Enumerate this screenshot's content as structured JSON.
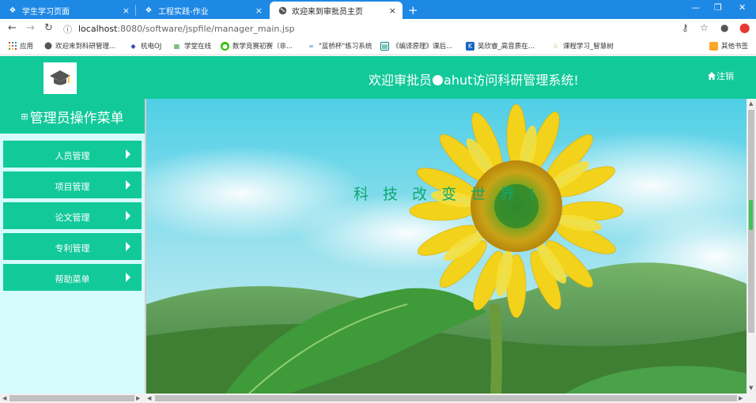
{
  "browser": {
    "tabs": [
      {
        "title": "学生学习页面",
        "close": "×"
      },
      {
        "title": "工程实践-作业",
        "close": "×"
      },
      {
        "title": "欢迎来到审批员主页",
        "close": "×"
      }
    ],
    "new_tab": "+",
    "url_host": "localhost",
    "url_path": ":8080/software/jspfile/manager_main.jsp"
  },
  "bookmarks": [
    {
      "label": "应用",
      "icon": "apps-grid-icon",
      "color": "#e53935"
    },
    {
      "label": "欢迎来到科研管理...",
      "icon": "globe-icon",
      "color": "#555555"
    },
    {
      "label": "杭电OJ",
      "icon": "site-icon",
      "color": "#3949ab"
    },
    {
      "label": "学堂在线",
      "icon": "school-icon",
      "color": "#43a047"
    },
    {
      "label": "数学竞赛初赛（非...",
      "icon": "wechat-icon",
      "color": "#2ec100"
    },
    {
      "label": "\"蓝桥杯\"练习系统",
      "icon": "lanqiao-icon",
      "color": "#1e88e5"
    },
    {
      "label": "《编译原理》课后...",
      "icon": "book-icon",
      "color": "#00897b"
    },
    {
      "label": "吴欣睿_高音质在...",
      "icon": "music-icon",
      "color": "#1565c0"
    },
    {
      "label": "课程学习_智慧树",
      "icon": "tree-icon",
      "color": "#7cb342"
    },
    {
      "label": "其他书签",
      "icon": "folder-icon",
      "color": "#f9a825"
    }
  ],
  "header": {
    "welcome_prefix": "欢迎审批员",
    "welcome_suffix": "ahut访问科研管理系统!",
    "logout": "注销"
  },
  "sidebar": {
    "title": "管理员操作菜单",
    "items": [
      {
        "label": "人员管理"
      },
      {
        "label": "项目管理"
      },
      {
        "label": "论文管理"
      },
      {
        "label": "专利管理"
      },
      {
        "label": "帮助菜单"
      }
    ]
  },
  "banner": {
    "slogan": "科 技 改 变 世 界 !"
  },
  "colors": {
    "primary": "#12c99a",
    "sidebar_bg": "#d6fbfb",
    "tabbar": "#1e88e5",
    "slogan": "#0fa86f"
  }
}
